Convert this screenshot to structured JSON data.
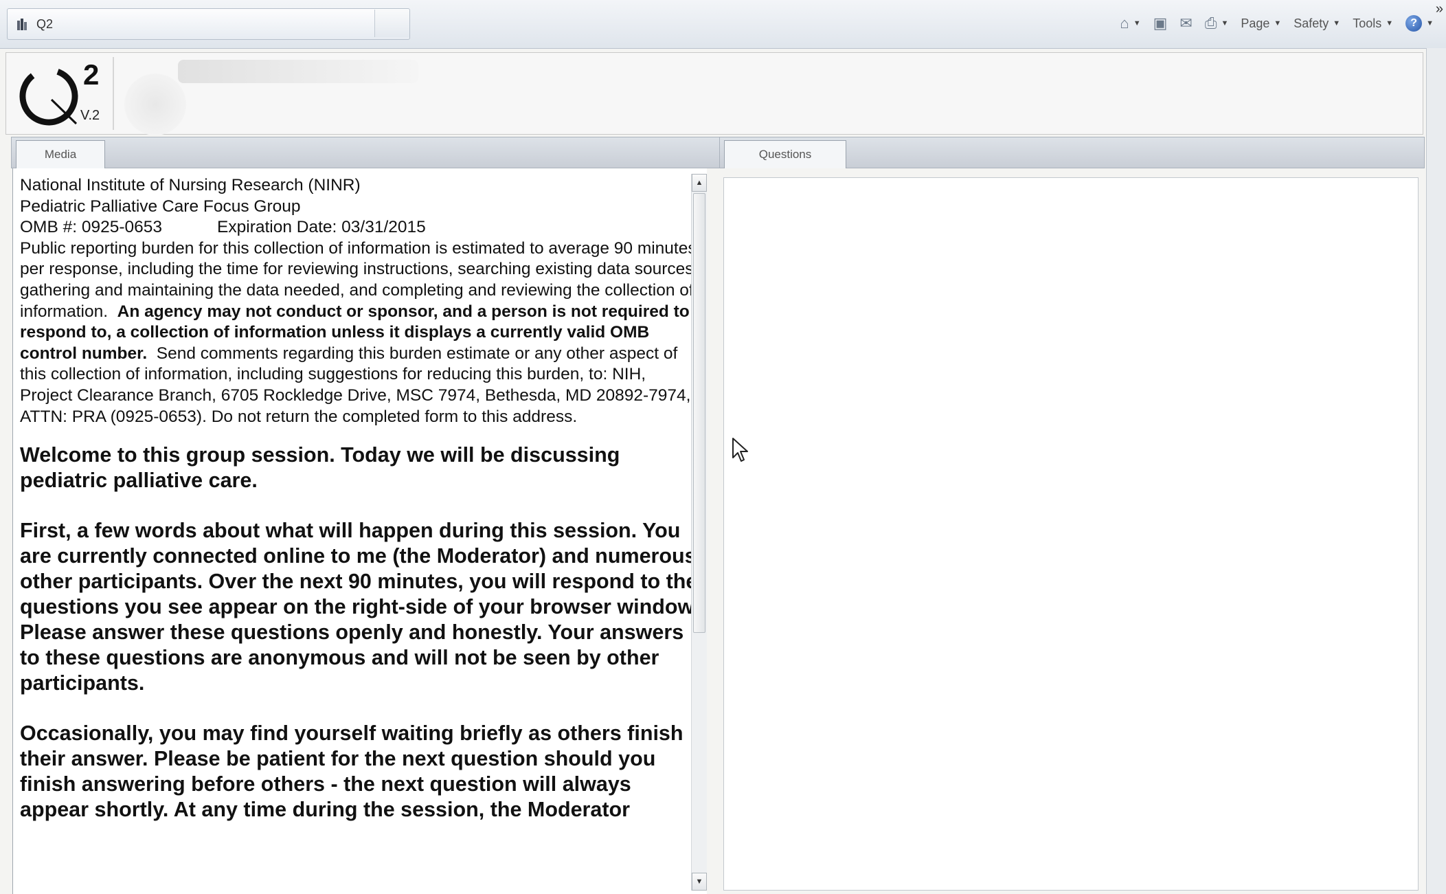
{
  "browser": {
    "tab_title": "Q2",
    "menu": {
      "page": "Page",
      "safety": "Safety",
      "tools": "Tools"
    },
    "overflow": "»"
  },
  "app": {
    "logo_sup": "2",
    "logo_version": "V.2"
  },
  "panels": {
    "media_tab": "Media",
    "questions_tab": "Questions"
  },
  "media": {
    "org": "National Institute of Nursing Research (NINR)",
    "group": "Pediatric Palliative Care Focus Group",
    "omb": "OMB #: 0925-0653",
    "expiration": "Expiration Date: 03/31/2015",
    "burden_intro": "Public reporting burden for this collection of information is estimated to average 90 minutes per response, including the time for reviewing instructions, searching existing data sources, gathering and maintaining the data needed, and completing and reviewing the collection of information.",
    "burden_bold": "An agency may not conduct or sponsor, and a person is not required to respond to, a collection of information unless it displays a currently valid OMB control number.",
    "burden_rest": "Send comments regarding this burden estimate or any other aspect of this collection of information, including suggestions for reducing this burden, to: NIH, Project Clearance Branch, 6705 Rockledge Drive, MSC 7974, Bethesda, MD 20892-7974, ATTN: PRA (0925-0653).  Do not return the completed form to this address.",
    "welcome": "Welcome to this group session. Today we will be discussing pediatric palliative care.",
    "first": "First, a few words about what will happen during this session. You are currently connected online to me (the Moderator) and numerous other participants. Over the next 90 minutes, you will respond to the questions you see appear on the right-side of your browser window. Please answer these questions openly and honestly. Your answers to these questions are anonymous and will not be seen by other participants.",
    "occasionally": "Occasionally, you may find yourself waiting briefly as others finish their answer. Please be patient for the next question should you finish answering before others - the next question will always appear shortly. At any time during the session, the Moderator"
  }
}
